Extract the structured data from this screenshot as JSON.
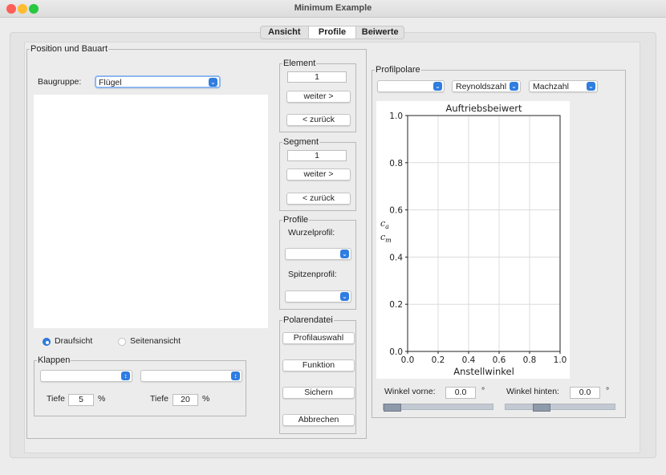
{
  "window": {
    "title": "Minimum Example",
    "traffic_lights": [
      "#fe5f57",
      "#febc2e",
      "#28c840"
    ]
  },
  "tabs": [
    {
      "label": "Ansicht",
      "active": false
    },
    {
      "label": "Profile",
      "active": true
    },
    {
      "label": "Beiwerte",
      "active": false
    }
  ],
  "position": {
    "title": "Position und Bauart",
    "baugruppe_label": "Baugruppe:",
    "baugruppe_value": "Flügel",
    "view_options": {
      "draufsicht": "Draufsicht",
      "seitenansicht": "Seitenansicht",
      "selected": "Draufsicht"
    },
    "klappen": {
      "title": "Klappen",
      "tiefe_label": "Tiefe",
      "tiefe_left": "5",
      "tiefe_right": "20",
      "unit": "%"
    }
  },
  "element": {
    "title": "Element",
    "value": "1",
    "next": "weiter >",
    "prev": "< zurück"
  },
  "segment": {
    "title": "Segment",
    "value": "1",
    "next": "weiter >",
    "prev": "< zurück"
  },
  "profile": {
    "title": "Profile",
    "wurzel_label": "Wurzelprofil:",
    "spitzen_label": "Spitzenprofil:"
  },
  "polarendatei": {
    "title": "Polarendatei",
    "buttons": [
      "Profilauswahl",
      "Funktion",
      "Sichern",
      "Abbrechen"
    ]
  },
  "profilpolare": {
    "title": "Profilpolare",
    "combos": [
      "",
      "Reynoldszahl",
      "Machzahl"
    ],
    "winkel_vorne_label": "Winkel vorne:",
    "winkel_vorne": "0.0",
    "winkel_hinten_label": "Winkel hinten:",
    "winkel_hinten": "0.0",
    "degree": "°",
    "slider_vorne_fraction": 0.0,
    "slider_hinten_fraction": 0.3
  },
  "chart_data": {
    "type": "line",
    "title": "Auftriebsbeiwert",
    "xlabel": "Anstellwinkel",
    "ylabel_lines": [
      "c",
      "c"
    ],
    "ylabel_subscripts": [
      "a",
      "m"
    ],
    "xlim": [
      0.0,
      1.0
    ],
    "ylim": [
      0.0,
      1.0
    ],
    "xticks": [
      "0.0",
      "0.2",
      "0.4",
      "0.6",
      "0.8",
      "1.0"
    ],
    "yticks": [
      "0.0",
      "0.2",
      "0.4",
      "0.6",
      "0.8",
      "1.0"
    ],
    "grid": true,
    "series": []
  }
}
